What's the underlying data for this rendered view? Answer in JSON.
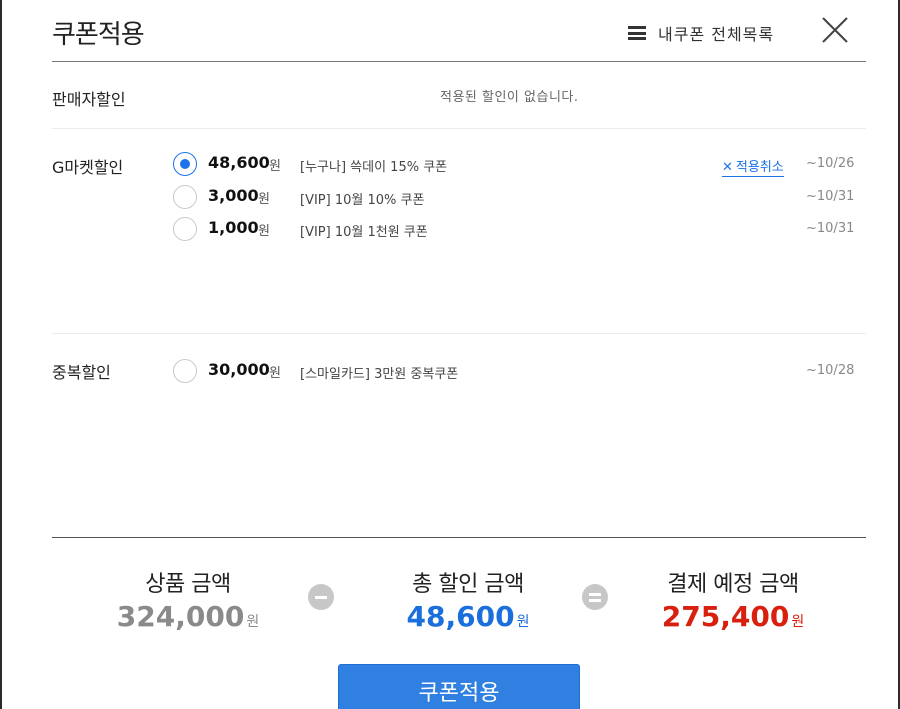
{
  "header": {
    "title": "쿠폰적용",
    "coupon_list_link": "내쿠폰 전체목록",
    "close_icon": "close-x-icon"
  },
  "seller": {
    "label": "판매자할인",
    "empty_text": "적용된 할인이 없습니다."
  },
  "gmarket": {
    "label": "G마켓할인",
    "coupons": [
      {
        "amount": "48,600",
        "won": "원",
        "name": "[누구나] 쓱데이 15% 쿠폰",
        "expiry": "~10/26",
        "selected": true,
        "cancel_label": "적용취소"
      },
      {
        "amount": "3,000",
        "won": "원",
        "name": "[VIP] 10월 10% 쿠폰",
        "expiry": "~10/31",
        "selected": false
      },
      {
        "amount": "1,000",
        "won": "원",
        "name": "[VIP] 10월 1천원 쿠폰",
        "expiry": "~10/31",
        "selected": false
      }
    ]
  },
  "duplicate": {
    "label": "중복할인",
    "coupons": [
      {
        "amount": "30,000",
        "won": "원",
        "name": "[스마일카드] 3만원 중복쿠폰",
        "expiry": "~10/28",
        "selected": false
      }
    ]
  },
  "summary": {
    "product_label": "상품 금액",
    "product_value": "324,000",
    "discount_label": "총 할인 금액",
    "discount_value": "48,600",
    "payment_label": "결제 예정 금액",
    "payment_value": "275,400",
    "won": "원"
  },
  "colors": {
    "accent": "#1a73e8",
    "discount_blue": "#1a6fdc",
    "payment_red": "#d9200f",
    "product_gray": "#8a8a8a"
  },
  "footer": {
    "apply_label": "쿠폰적용"
  }
}
